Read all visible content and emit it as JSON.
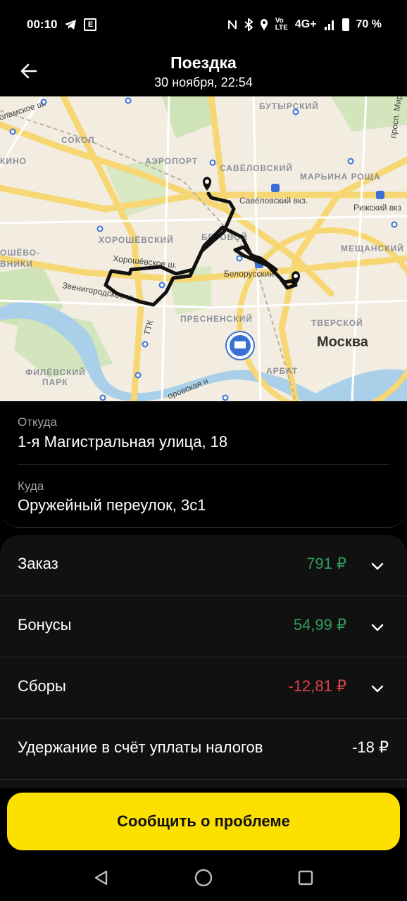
{
  "status_bar": {
    "time": "00:10",
    "network": "4G+",
    "battery": "70 %"
  },
  "header": {
    "title": "Поездка",
    "subtitle": "30 ноября, 22:54"
  },
  "map": {
    "labels": {
      "butyrsky": "БУТЫРСКИЙ",
      "kolamskoe": "оламское ш.",
      "sokol": "СОКОЛ",
      "kino": "КИНО",
      "aeroport": "АЭРОПОРТ",
      "savelovsky": "САВЁЛОВСКИЙ",
      "maryina": "МАРЬИНА РОЩА",
      "savelovsky_station": "Савёловский вкз.",
      "rizhsky": "Рижский вкз",
      "khoroshevsky": "ХОРОШЁВСКИЙ",
      "begovoy": "БЕГОВОЙ",
      "meshchansky": "МЕЩАНСКИЙ",
      "khoroshevo": "ОШЁВО-",
      "vniki": "ВНИКИ",
      "khoroshevskoe_sh": "Хорошёвское ш.",
      "belorussky": "Белорусский",
      "zvenigorodskoe": "Звенигородское ш.",
      "ttk": "ТТК",
      "presnensky": "ПРЕСНЕНСКИЙ",
      "tverskoy": "ТВЕРСКОЙ",
      "moskva": "Москва",
      "filevsky": "ФИЛЁВСКИЙ",
      "park": "ПАРК",
      "arbat": "АРБАТ",
      "berezhkovskaya": "оровская н",
      "prosp_mira": "просп. Мира"
    }
  },
  "trip": {
    "from_label": "Откуда",
    "from_value": "1-я Магистральная улица, 18",
    "to_label": "Куда",
    "to_value": "Оружейный переулок, 3с1"
  },
  "payment": {
    "rows": [
      {
        "label": "Заказ",
        "amount": "791 ₽"
      },
      {
        "label": "Бонусы",
        "amount": "54,99 ₽"
      },
      {
        "label": "Сборы",
        "amount": "-12,81 ₽"
      },
      {
        "label": "Удержание в счёт уплаты налогов",
        "amount": "-18 ₽"
      }
    ],
    "colors": {
      "positive": "#2e9e5b",
      "negative": "#e0424a"
    }
  },
  "cta": {
    "label": "Сообщить о проблеме"
  }
}
